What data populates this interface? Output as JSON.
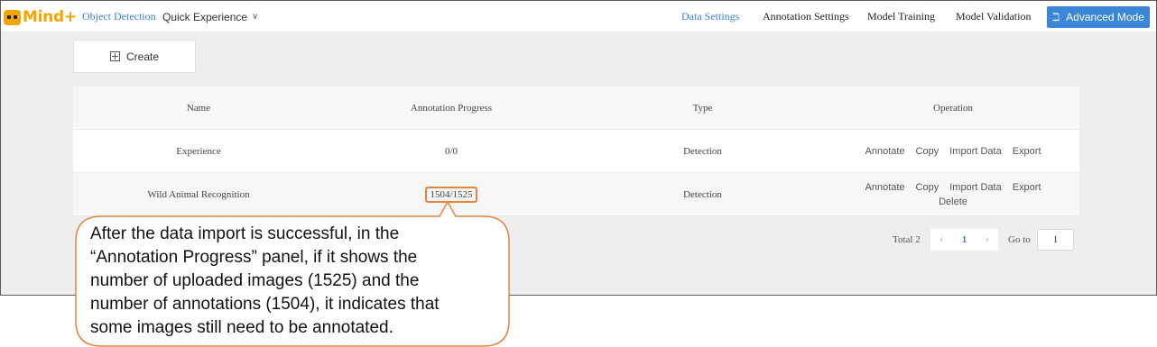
{
  "app": {
    "logo_text": "Mind+"
  },
  "nav": {
    "object_detection": "Object Detection",
    "quick_experience": "Quick Experience",
    "data_settings": "Data Settings",
    "annotation_settings": "Annotation Settings",
    "model_training": "Model Training",
    "model_validation": "Model Validation",
    "advanced_mode": "Advanced Mode",
    "advanced_icon": "bulb-icon"
  },
  "toolbar": {
    "create_label": "Create"
  },
  "table": {
    "headers": [
      "Name",
      "Annotation Progress",
      "Type",
      "Operation"
    ],
    "rows": [
      {
        "name": "Experience",
        "progress": "0/0",
        "type": "Detection",
        "ops": [
          "Annotate",
          "Copy",
          "Import Data",
          "Export"
        ]
      },
      {
        "name": "Wild Animal Recognition",
        "progress": "1504/1525",
        "type": "Detection",
        "ops": [
          "Annotate",
          "Copy",
          "Import Data",
          "Export",
          "Delete"
        ]
      }
    ]
  },
  "pagination": {
    "total": "Total 2",
    "current_page": "1",
    "goto_label": "Go to",
    "goto_value": "1"
  },
  "callout": {
    "text": "After the data import is successful, in the\n “Annotation Progress”  panel, if it shows the\nnumber of uploaded images (1525) and the\nnumber of annotations (1504), it indicates that\nsome images still need to be annotated."
  },
  "colors": {
    "accent": "#3a86d8",
    "brand": "#f2a500",
    "callout_border": "#e8833a"
  }
}
